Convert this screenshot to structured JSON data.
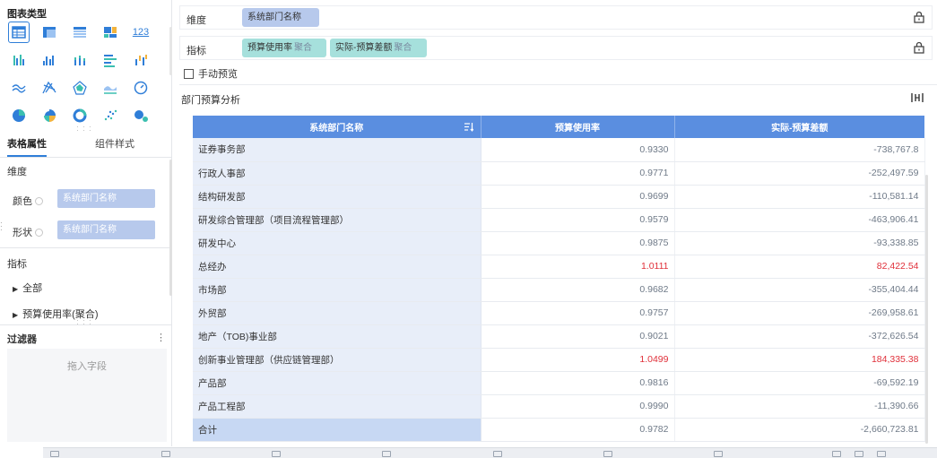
{
  "left_panel": {
    "chart_type_title": "图表类型",
    "chart_type_icons": [
      "table-icon",
      "cross-table-icon",
      "detail-table-icon",
      "treemap-icon",
      "kpi-number-icon",
      "grouped-bar-icon",
      "column-icon",
      "stacked-column-icon",
      "bar-icon",
      "waterfall-icon",
      "line-icon",
      "radar-icon",
      "radar-fill-icon",
      "area-icon",
      "gauge-icon",
      "pie-icon",
      "rose-pie-icon",
      "donut-icon",
      "scatter-icon",
      "bubble-icon"
    ],
    "kpi_label": "123",
    "tabs": [
      "表格属性",
      "组件样式"
    ],
    "dimension_title": "维度",
    "color_label": "颜色",
    "color_field": "系统部门名称",
    "shape_label": "形状",
    "shape_field": "系统部门名称",
    "measure_title": "指标",
    "measure_items": [
      "全部",
      "预算使用率(聚合)"
    ],
    "filter_title": "过滤器",
    "filter_placeholder": "拖入字段",
    "filter_menu": "⋮"
  },
  "shelves": {
    "dimension": {
      "label": "维度",
      "pills": [
        {
          "name": "系统部门名称"
        }
      ]
    },
    "measure": {
      "label": "指标",
      "pills": [
        {
          "name": "预算使用率",
          "agg": "聚合"
        },
        {
          "name": "实际-预算差额",
          "agg": "聚合"
        }
      ]
    }
  },
  "manual_preview": {
    "label": "手动预览",
    "checked": false
  },
  "chart_title": "部门预算分析",
  "colors": {
    "header_bg": "#5a8ee0",
    "dimension_pill": "#b7c9ec",
    "measure_pill": "#a6e0dc",
    "row_dim_bg": "#e8eef9",
    "negative_red": "#e0303a",
    "accent": "#2f7ed8"
  },
  "chart_data": {
    "type": "table",
    "columns": [
      "系统部门名称",
      "预算使用率",
      "实际-预算差额"
    ],
    "rows": [
      {
        "dept": "证券事务部",
        "rate": "0.9330",
        "diff": "-738,767.8",
        "highlight": false
      },
      {
        "dept": "行政人事部",
        "rate": "0.9771",
        "diff": "-252,497.59",
        "highlight": false
      },
      {
        "dept": "结构研发部",
        "rate": "0.9699",
        "diff": "-110,581.14",
        "highlight": false
      },
      {
        "dept": "研发综合管理部（项目流程管理部）",
        "rate": "0.9579",
        "diff": "-463,906.41",
        "highlight": false
      },
      {
        "dept": "研发中心",
        "rate": "0.9875",
        "diff": "-93,338.85",
        "highlight": false
      },
      {
        "dept": "总经办",
        "rate": "1.0111",
        "diff": "82,422.54",
        "highlight": true
      },
      {
        "dept": "市场部",
        "rate": "0.9682",
        "diff": "-355,404.44",
        "highlight": false
      },
      {
        "dept": "外贸部",
        "rate": "0.9757",
        "diff": "-269,958.61",
        "highlight": false
      },
      {
        "dept": "地产（TOB)事业部",
        "rate": "0.9021",
        "diff": "-372,626.54",
        "highlight": false
      },
      {
        "dept": "创新事业管理部（供应链管理部）",
        "rate": "1.0499",
        "diff": "184,335.38",
        "highlight": true
      },
      {
        "dept": "产品部",
        "rate": "0.9816",
        "diff": "-69,592.19",
        "highlight": false
      },
      {
        "dept": "产品工程部",
        "rate": "0.9990",
        "diff": "-11,390.66",
        "highlight": false
      }
    ],
    "total": {
      "dept": "合计",
      "rate": "0.9782",
      "diff": "-2,660,723.81"
    }
  }
}
